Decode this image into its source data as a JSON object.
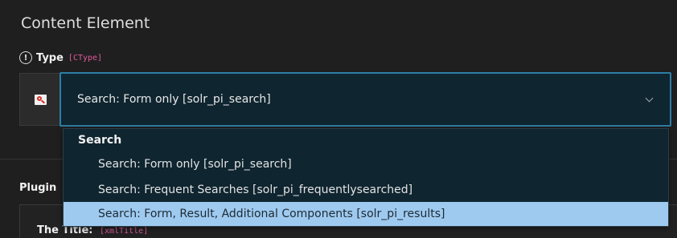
{
  "panel": {
    "title": "Content Element"
  },
  "type_field": {
    "label": "Type",
    "key": "[CType]",
    "selected_value": "Search: Form only [solr_pi_search]"
  },
  "dropdown": {
    "group_label": "Search",
    "options": [
      "Search: Form only [solr_pi_search]",
      "Search: Frequent Searches [solr_pi_frequentlysearched]",
      "Search: Form, Result, Additional Components [solr_pi_results]"
    ],
    "highlighted_index": 2
  },
  "plugin_section": {
    "label": "Plugin",
    "field_label": "The Title:",
    "field_key": "[xmlTitle]"
  },
  "colors": {
    "accent": "#2e7ea6",
    "highlight": "#9fcaf0",
    "field_key": "#e05a9a"
  }
}
